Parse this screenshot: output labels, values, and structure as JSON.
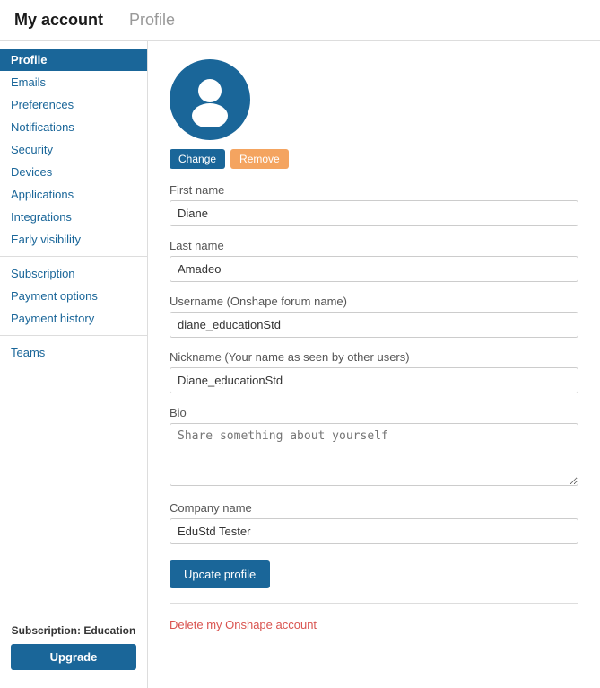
{
  "header": {
    "title": "My account",
    "separator": " ",
    "subtitle": "Profile"
  },
  "sidebar": {
    "active_item": "Profile",
    "items_top": [
      {
        "id": "profile",
        "label": "Profile"
      },
      {
        "id": "emails",
        "label": "Emails"
      },
      {
        "id": "preferences",
        "label": "Preferences"
      },
      {
        "id": "notifications",
        "label": "Notifications"
      },
      {
        "id": "security",
        "label": "Security"
      },
      {
        "id": "devices",
        "label": "Devices"
      },
      {
        "id": "applications",
        "label": "Applications"
      },
      {
        "id": "integrations",
        "label": "Integrations"
      },
      {
        "id": "early-visibility",
        "label": "Early visibility"
      }
    ],
    "items_middle": [
      {
        "id": "subscription",
        "label": "Subscription"
      },
      {
        "id": "payment-options",
        "label": "Payment options"
      },
      {
        "id": "payment-history",
        "label": "Payment history"
      }
    ],
    "items_bottom": [
      {
        "id": "teams",
        "label": "Teams"
      }
    ],
    "subscription_label": "Subscription: Education",
    "upgrade_label": "Upgrade"
  },
  "avatar": {
    "change_label": "Change",
    "remove_label": "Remove"
  },
  "form": {
    "first_name_label": "First name",
    "first_name_value": "Diane",
    "last_name_label": "Last name",
    "last_name_value": "Amadeo",
    "username_label": "Username (Onshape forum name)",
    "username_value": "diane_educationStd",
    "nickname_label": "Nickname (Your name as seen by other users)",
    "nickname_value": "Diane_educationStd",
    "bio_label": "Bio",
    "bio_placeholder": "Share something about yourself",
    "company_label": "Company name",
    "company_value": "EduStd Tester",
    "update_label": "Upcate profile",
    "delete_label": "Delete my Onshape account"
  }
}
